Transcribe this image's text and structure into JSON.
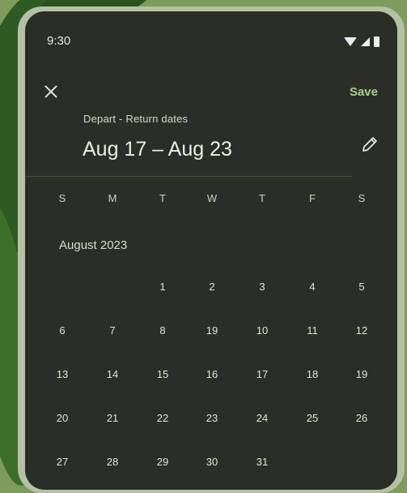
{
  "status_bar": {
    "time": "9:30"
  },
  "header": {
    "save_label": "Save",
    "label": "Depart - Return dates",
    "date_range": "Aug 17 – Aug 23"
  },
  "calendar": {
    "weekdays": [
      "S",
      "M",
      "T",
      "W",
      "T",
      "F",
      "S"
    ],
    "month": "August 2023",
    "weeks": [
      [
        "",
        "",
        "1",
        "2",
        "3",
        "4",
        "5"
      ],
      [
        "6",
        "7",
        "8",
        "19",
        "10",
        "11",
        "12"
      ],
      [
        "13",
        "14",
        "15",
        "16",
        "17",
        "18",
        "19"
      ],
      [
        "20",
        "21",
        "22",
        "23",
        "24",
        "25",
        "26"
      ],
      [
        "27",
        "28",
        "29",
        "30",
        "31",
        "",
        ""
      ]
    ]
  },
  "colors": {
    "surface": "#2a2e26",
    "accent": "#a9cf8a",
    "text": "#e4e6dc"
  },
  "icons": [
    "wifi-icon",
    "signal-icon",
    "battery-icon",
    "close-icon",
    "edit-icon"
  ]
}
